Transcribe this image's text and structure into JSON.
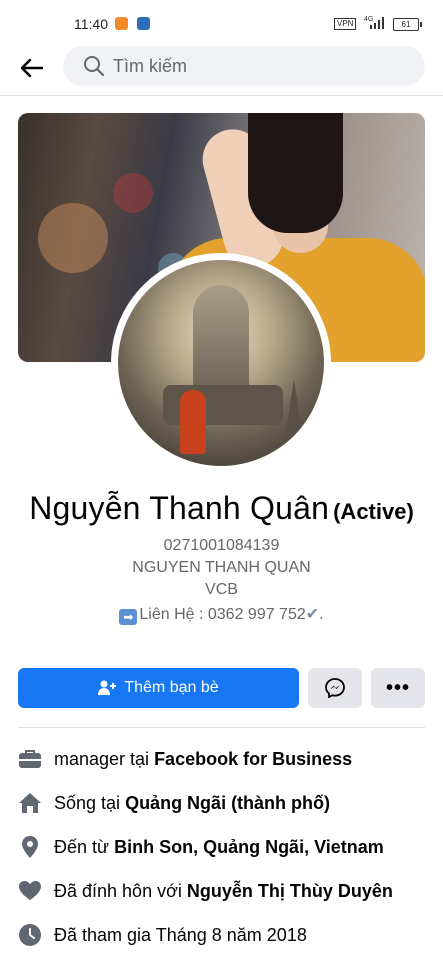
{
  "status_bar": {
    "time": "11:40",
    "vpn": "VPN",
    "network": "4G",
    "battery": "61"
  },
  "search": {
    "placeholder": "Tìm kiếm"
  },
  "profile": {
    "name": "Nguyễn Thanh Quân",
    "name_suffix": "(Active)",
    "bio_lines": [
      "0271001084139",
      "NGUYEN THANH QUAN",
      "VCB"
    ],
    "contact_text": "Liên Hệ : 0362 997 752",
    "contact_end": "."
  },
  "actions": {
    "add_friend_label": "Thêm bạn bè",
    "more_label": "•••"
  },
  "info": [
    {
      "icon": "briefcase-icon",
      "prefix": "manager tại ",
      "value": "Facebook for Business"
    },
    {
      "icon": "home-icon",
      "prefix": "Sống tại ",
      "value": "Quảng Ngãi (thành phố)"
    },
    {
      "icon": "location-pin-icon",
      "prefix": "Đến từ ",
      "value": "Binh Son, Quảng Ngãi, Vietnam"
    },
    {
      "icon": "heart-icon",
      "prefix": "Đã đính hôn với ",
      "value": "Nguyễn Thị Thùy Duyên"
    },
    {
      "icon": "clock-icon",
      "prefix": "Đã tham gia Tháng 8 năm 2018",
      "value": ""
    }
  ],
  "colors": {
    "primary": "#1877f2",
    "secondary_button": "#e4e6eb",
    "icon_gray": "#606770"
  }
}
